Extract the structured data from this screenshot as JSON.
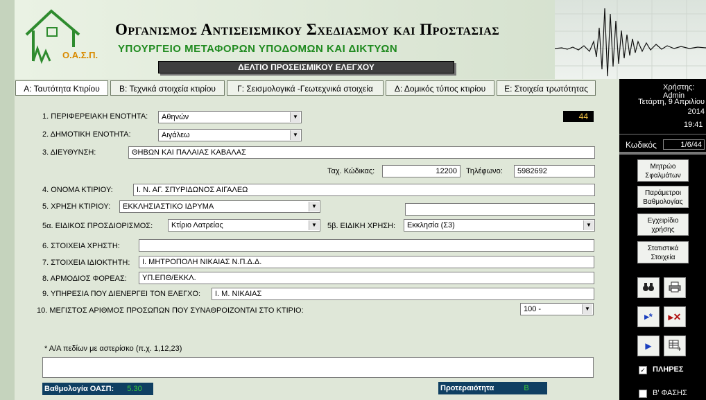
{
  "header": {
    "org_title": "Οργανισμος Αντισεισμικου Σχεδιασμου και Προστασιας",
    "ministry": "ΥΠΟΥΡΓΕΙΟ ΜΕΤΑΦΟΡΩΝ ΥΠΟΔΟΜΩΝ ΚΑΙ ΔΙΚΤΥΩΝ",
    "form_title": "ΔΕΛΤΙΟ ΠΡΟΣΕΙΣΜΙΚΟΥ ΕΛΕΓΧΟΥ",
    "logo_text": "Ο.Α.Σ.Π."
  },
  "tabs": [
    {
      "label": "Α: Ταυτότητα Κτιρίου"
    },
    {
      "label": "Β: Τεχνικά στοιχεία κτιρίου"
    },
    {
      "label": "Γ: Σεισμολογικά -Γεωτεχνικά στοιχεία"
    },
    {
      "label": "Δ: Δομικός τύπος κτιρίου"
    },
    {
      "label": "Ε: Στοιχεία τρωτότητας"
    }
  ],
  "side": {
    "user": "Χρήστης: Admin",
    "date": "Τετάρτη, 9 Απριλίου 2014",
    "time": "19:41",
    "code_label": "Κωδικός",
    "code_value": "1/6/44",
    "buttons": [
      "Μητρώο Σφαλμάτων",
      "Παράμετροι Βαθμολογίας",
      "Εγχειρίδιο χρήσης",
      "Στατιστικά Στοιχεία"
    ],
    "check_full": "ΠΛΗΡΕΣ",
    "check_phase": "Β' ΦΑΣΗΣ"
  },
  "form": {
    "counter": "44",
    "f1_label": "1. ΠΕΡΙΦΕΡΕΙΑΚΗ ΕΝΟΤΗΤΑ:",
    "f1_value": "Αθηνών",
    "f2_label": "2. ΔΗΜΟΤΙΚΗ ΕΝΟΤΗΤΑ:",
    "f2_value": "Αιγάλεω",
    "f3_label": "3. ΔΙΕΥΘΥΝΣΗ:",
    "f3_value": "ΘΗΒΩΝ ΚΑΙ ΠΑΛΑΙΑΣ ΚΑΒΑΛΑΣ",
    "tk_label": "Ταχ. Κώδικας:",
    "tk_value": "12200",
    "tel_label": "Τηλέφωνο:",
    "tel_value": "5982692",
    "f4_label": "4. ΟΝΟΜΑ ΚΤΙΡΙΟΥ:",
    "f4_value": "Ι. Ν. ΑΓ. ΣΠΥΡΙΔΩΝΟΣ ΑΙΓΑΛΕΩ",
    "f5_label": "5. ΧΡΗΣΗ ΚΤΙΡΙΟΥ:",
    "f5_value": "ΕΚΚΛΗΣΙΑΣΤΙΚΟ ΙΔΡΥΜΑ",
    "f5a_label": "5α. ΕΙΔΙΚΟΣ ΠΡΟΣΔΙΟΡΙΣΜΟΣ:",
    "f5a_value": "Κτίριο Λατρείας",
    "f5b_label": "5β. ΕΙΔΙΚΗ ΧΡΗΣΗ:",
    "f5b_value": "Εκκλησία (Σ3)",
    "f6_label": "6. ΣΤΟΙΧΕΙΑ ΧΡΗΣΤΗ:",
    "f6_value": "",
    "f7_label": "7. ΣΤΟΙΧΕΙΑ ΙΔΙΟΚΤΗΤΗ:",
    "f7_value": "Ι. ΜΗΤΡΟΠΟΛΗ ΝΙΚΑΙΑΣ Ν.Π.Δ.Δ.",
    "f8_label": "8. ΑΡΜΟΔΙΟΣ ΦΟΡΕΑΣ:",
    "f8_value": "ΥΠ.ΕΠΘ/ΕΚΚΛ.",
    "f9_label": "9. ΥΠΗΡΕΣΙΑ ΠΟΥ ΔΙΕΝΕΡΓΕΙ ΤΟΝ ΕΛΕΓΧΟ:",
    "f9_value": "Ι. Μ. ΝΙΚΑΙΑΣ",
    "f10_label": "10. ΜΕΓΙΣΤΟΣ ΑΡΙΘΜΟΣ ΠΡΟΣΩΠΩΝ ΠΟΥ ΣΥΝΑΘΡΟΙΖΟΝΤΑΙ ΣΤΟ ΚΤΙΡΙΟ:",
    "f10_value": "100 -",
    "note": "* Α/Α πεδίων με αστερίσκο (π.χ. 1,12,23)",
    "score_label": "Βαθμολογία ΟΑΣΠ:",
    "score_value": "5.30",
    "priority_label": "Προτεραιότητα",
    "priority_value": "Β"
  }
}
